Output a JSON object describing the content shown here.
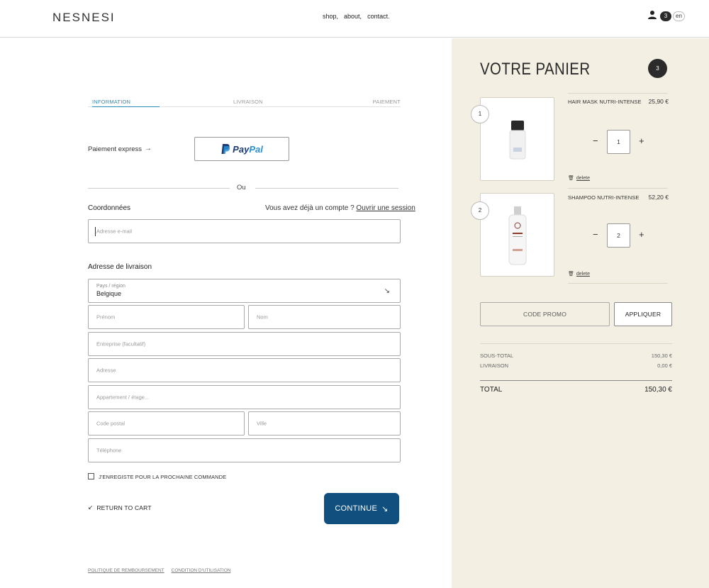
{
  "header": {
    "logo": "NESNESI",
    "nav": [
      "shop,",
      "about,",
      "contact."
    ],
    "cart_count": "3",
    "language": "en"
  },
  "steps": {
    "information": "INFORMATION",
    "delivery": "LIVRAISON",
    "payment": "PAIEMENT"
  },
  "express": {
    "label": "Paiement express",
    "arrow": "→",
    "paypal_a": "Pay",
    "paypal_b": "Pal"
  },
  "divider": {
    "or": "Ou"
  },
  "contact": {
    "title": "Coordonnées",
    "account_question": "Vous avez déjà un compte ? ",
    "account_link": "Ouvrir une session",
    "email_placeholder": "Adresse e-mail"
  },
  "shipping": {
    "title": "Adresse de livraison",
    "country_label": "Pays / région",
    "country_value": "Belgique",
    "first_name": "Prénom",
    "last_name": "Nom",
    "company": "Entreprise (facultatif)",
    "address": "Adresse",
    "apartment": "Appartement / étage...",
    "postal_code": "Code postal",
    "city": "Ville",
    "phone": "Téléphone"
  },
  "save_info": "J'ENREGISTE POUR LA PROCHAINE COMMANDE",
  "actions": {
    "return_cart": "RETURN TO CART",
    "continue": "CONTINUE"
  },
  "footer": {
    "refund": "POLITIQUE DE REMBOURSEMENT",
    "terms": "CONDITION D'UTILISATION"
  },
  "cart": {
    "title": "VOTRE PANIER",
    "count": "3",
    "items": [
      {
        "index": "1",
        "name": "HAIR MASK NUTRI-INTENSE",
        "price": "25,90 €",
        "qty": "1",
        "delete": "delete"
      },
      {
        "index": "2",
        "name": "SHAMPOO NUTRI-INTENSE",
        "price": "52,20 €",
        "qty": "2",
        "delete": "delete"
      }
    ],
    "minus": "−",
    "plus": "+",
    "promo_placeholder": "CODE PROMO",
    "apply": "APPLIQUER",
    "subtotal_label": "SOUS-TOTAL",
    "subtotal_value": "150,30 €",
    "shipping_label": "LIVRAISON",
    "shipping_value": "0,00 €",
    "total_label": "TOTAL",
    "total_value": "150,30 €"
  },
  "colors": {
    "accent": "#2b8cb5",
    "primary_button": "#11507e",
    "cart_background": "#f3efe3"
  }
}
